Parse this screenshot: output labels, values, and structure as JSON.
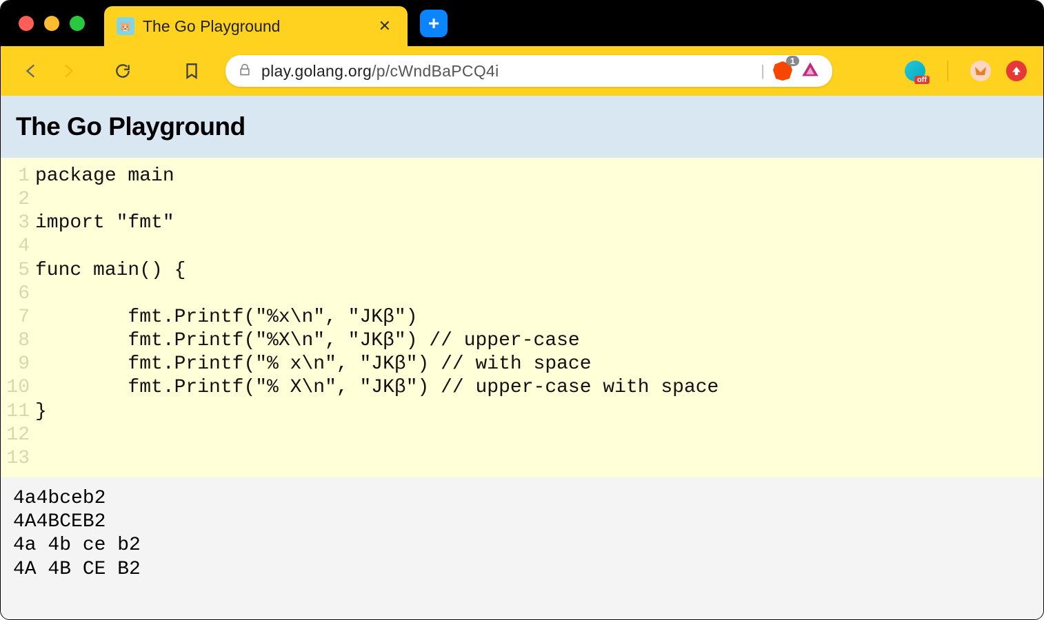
{
  "window": {
    "tab_title": "The Go Playground",
    "new_tab_label": "+"
  },
  "toolbar": {
    "url_host": "play.golang.org",
    "url_path": "/p/cWndBaPCQ4i",
    "brave_badge": "1",
    "off_badge": "off"
  },
  "page": {
    "title": "The Go Playground"
  },
  "editor": {
    "lines": [
      "package main",
      "",
      "import \"fmt\"",
      "",
      "func main() {",
      "",
      "        fmt.Printf(\"%x\\n\", \"JKβ\")",
      "        fmt.Printf(\"%X\\n\", \"JKβ\") // upper-case",
      "        fmt.Printf(\"% x\\n\", \"JKβ\") // with space",
      "        fmt.Printf(\"% X\\n\", \"JKβ\") // upper-case with space",
      "}",
      "",
      ""
    ]
  },
  "output": {
    "lines": [
      "4a4bceb2",
      "4A4BCEB2",
      "4a 4b ce b2",
      "4A 4B CE B2"
    ]
  }
}
